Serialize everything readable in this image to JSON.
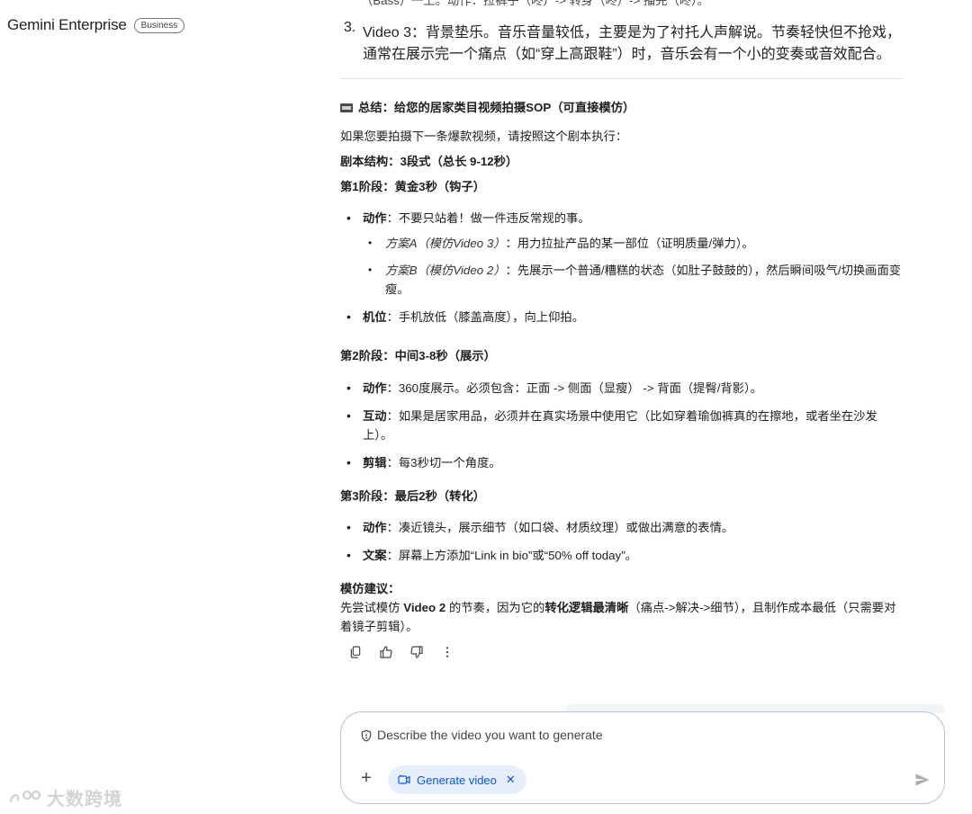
{
  "brand": {
    "name": "Gemini Enterprise",
    "badge": "Business"
  },
  "response": {
    "cut_line": "（Bass）一上。动作：拉裤子（咚）-> 转身（咚）-> 播完（咚）。",
    "video3": {
      "num": "3.",
      "label": "Video 3",
      "text": "：背景垫乐。音乐音量较低，主要是为了衬托人声解说。节奏轻快但不抢戏，通常在展示完一个痛点（如“穿上高跟鞋”）时，音乐会有一个小的变奏或音效配合。"
    },
    "summary_title": "总结：给您的居家类目视频拍摄SOP（可直接模仿）",
    "intro": "如果您要拍摄下一条爆款视频，请按照这个剧本执行：",
    "structure": "剧本结构：3段式（总长 9-12秒）",
    "stage1": {
      "title": "第1阶段：黄金3秒（钩子）",
      "action_label": "动作",
      "action_text": "：不要只站着！做一件违反常规的事。",
      "planA_label": "方案A（模仿Video 3）",
      "planA_text": "：用力拉扯产品的某一部位（证明质量/弹力）。",
      "planB_label": "方案B（模仿Video 2）",
      "planB_text": "：先展示一个普通/糟糕的状态（如肚子鼓鼓的），然后瞬间吸气/切换画面变瘦。",
      "camera_label": "机位",
      "camera_text": "：手机放低（膝盖高度），向上仰拍。"
    },
    "stage2": {
      "title": "第2阶段：中间3-8秒（展示）",
      "action_label": "动作",
      "action_text": "：360度展示。必须包含：正面 -> 侧面（显瘦） -> 背面（提臀/背影）。",
      "interact_label": "互动",
      "interact_text": "：如果是居家用品，必须并在真实场景中使用它（比如穿着瑜伽裤真的在擦地，或者坐在沙发上）。",
      "edit_label": "剪辑",
      "edit_text": "：每3秒切一个角度。"
    },
    "stage3": {
      "title": "第3阶段：最后2秒（转化）",
      "action_label": "动作",
      "action_text": "：凑近镜头，展示细节（如口袋、材质纹理）或做出满意的表情。",
      "copy_label": "文案",
      "copy_text": "：屏幕上方添加“Link in bio”或“50% off today”。"
    },
    "advice_title": "模仿建议：",
    "advice_pre": "先尝试模仿 ",
    "advice_video": "Video 2",
    "advice_mid": " 的节奏，因为它的",
    "advice_bold": "转化逻辑最清晰",
    "advice_post": "（痛点->解决->细节），且制作成本最低（只需要对着镜子剪辑）。"
  },
  "actions": {
    "icons": [
      "copy-icon",
      "thumbs-up-icon",
      "thumbs-down-icon",
      "more-vert-icon"
    ]
  },
  "composer": {
    "placeholder": "Describe the video you want to generate",
    "chip_label": "Generate video",
    "chip_close": "✕",
    "plus": "+"
  },
  "watermark": {
    "text": "大数跨境"
  },
  "colors": {
    "accent": "#0b57d0",
    "chip_bg": "#e8effc",
    "border": "#b7c3d8"
  }
}
